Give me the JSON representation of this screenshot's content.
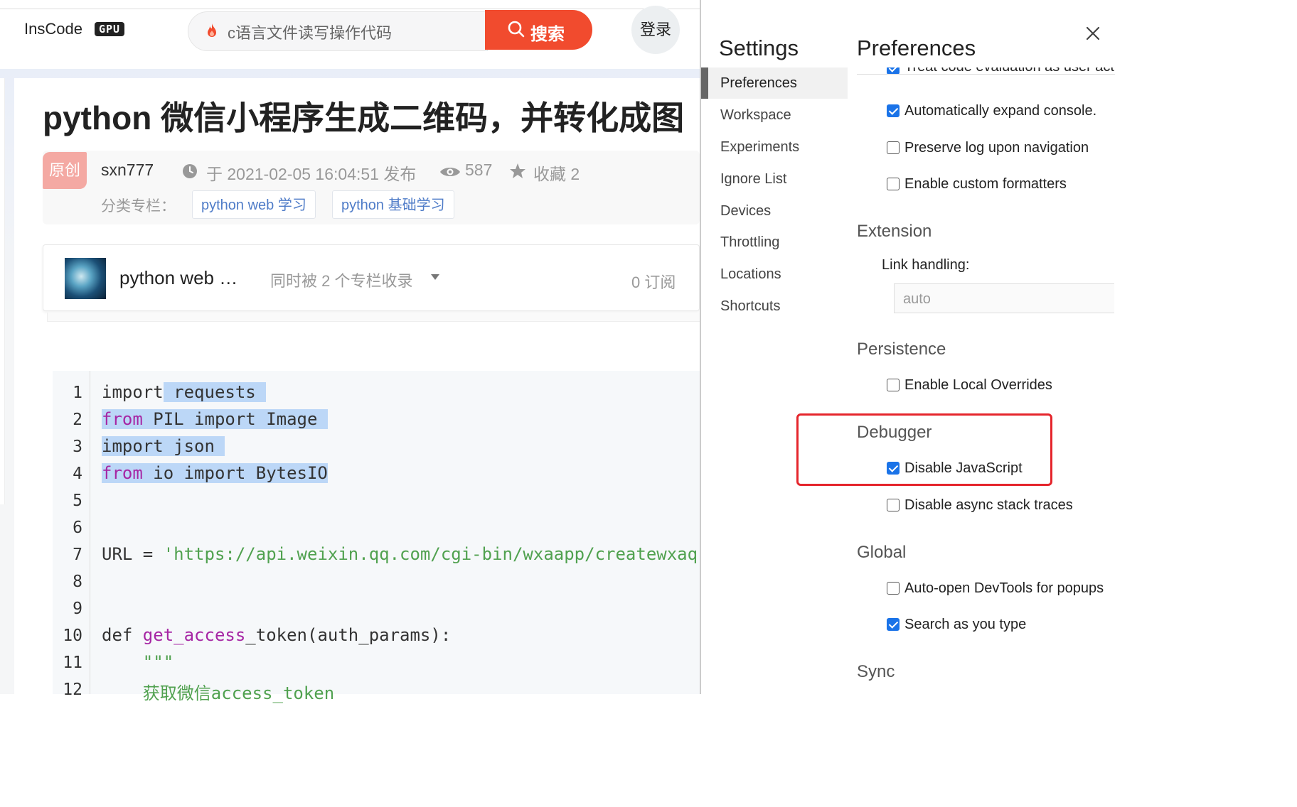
{
  "blog": {
    "logo": "InsCode",
    "logo_badge": "GPU",
    "search_query": "c语言文件读写操作代码",
    "search_button": "搜索",
    "login": "登录",
    "title": "python 微信小程序生成二维码，并转化成图",
    "original_badge": "原创",
    "author": "sxn777",
    "date": "于 2021-02-05 16:04:51 发布",
    "views": "587",
    "collect": "收藏 2",
    "category_label": "分类专栏：",
    "tags": [
      "python web 学习",
      "python 基础学习"
    ],
    "column_name": "python web …",
    "column_also": "同时被 2 个专栏收录",
    "subscriptions": "0 订阅"
  },
  "code": {
    "line_numbers": [
      "1",
      "2",
      "3",
      "4",
      "5",
      "6",
      "7",
      "8",
      "9",
      "10",
      "11",
      "12"
    ],
    "l1_kw": "import",
    "l1_rest": " requests ",
    "l2_kw": "from",
    "l2_rest": " PIL import Image ",
    "l3_kw": "import",
    "l3_rest": " json ",
    "l4_kw": "from",
    "l4_rest": " io import BytesIO",
    "l7_prefix": "URL = ",
    "l7_str": "'https://api.weixin.qq.com/cgi-bin/wxaapp/createwxaqrcode",
    "l10_kw": "def ",
    "l10_fn": "get_access",
    "l10_rest": "_token(auth_params):",
    "l11": "    \"\"\"",
    "l12": "    获取微信access_token"
  },
  "devtools": {
    "settings_title": "Settings",
    "prefs_title": "Preferences",
    "nav": [
      "Preferences",
      "Workspace",
      "Experiments",
      "Ignore List",
      "Devices",
      "Throttling",
      "Locations",
      "Shortcuts"
    ],
    "clipped_option": "Treat code evaluation as user action",
    "options": {
      "expand_console": "Automatically expand console.",
      "preserve_log": "Preserve log upon navigation",
      "custom_formatters": "Enable custom formatters",
      "local_overrides": "Enable Local Overrides",
      "disable_js": "Disable JavaScript",
      "disable_async": "Disable async stack traces",
      "auto_open": "Auto-open DevTools for popups",
      "search_as_type": "Search as you type"
    },
    "checked": {
      "treat_code": true,
      "expand_console": true,
      "preserve_log": false,
      "custom_formatters": false,
      "local_overrides": false,
      "disable_js": true,
      "disable_async": false,
      "auto_open": false,
      "search_as_type": true
    },
    "sections": {
      "extension": "Extension",
      "persistence": "Persistence",
      "debugger": "Debugger",
      "global": "Global",
      "sync": "Sync"
    },
    "link_handling_label": "Link handling:",
    "link_handling_value": "auto"
  },
  "colors": {
    "search_button": "#f14b2e",
    "checkbox_checked": "#1a73e8",
    "highlight_box": "#e5252c"
  }
}
